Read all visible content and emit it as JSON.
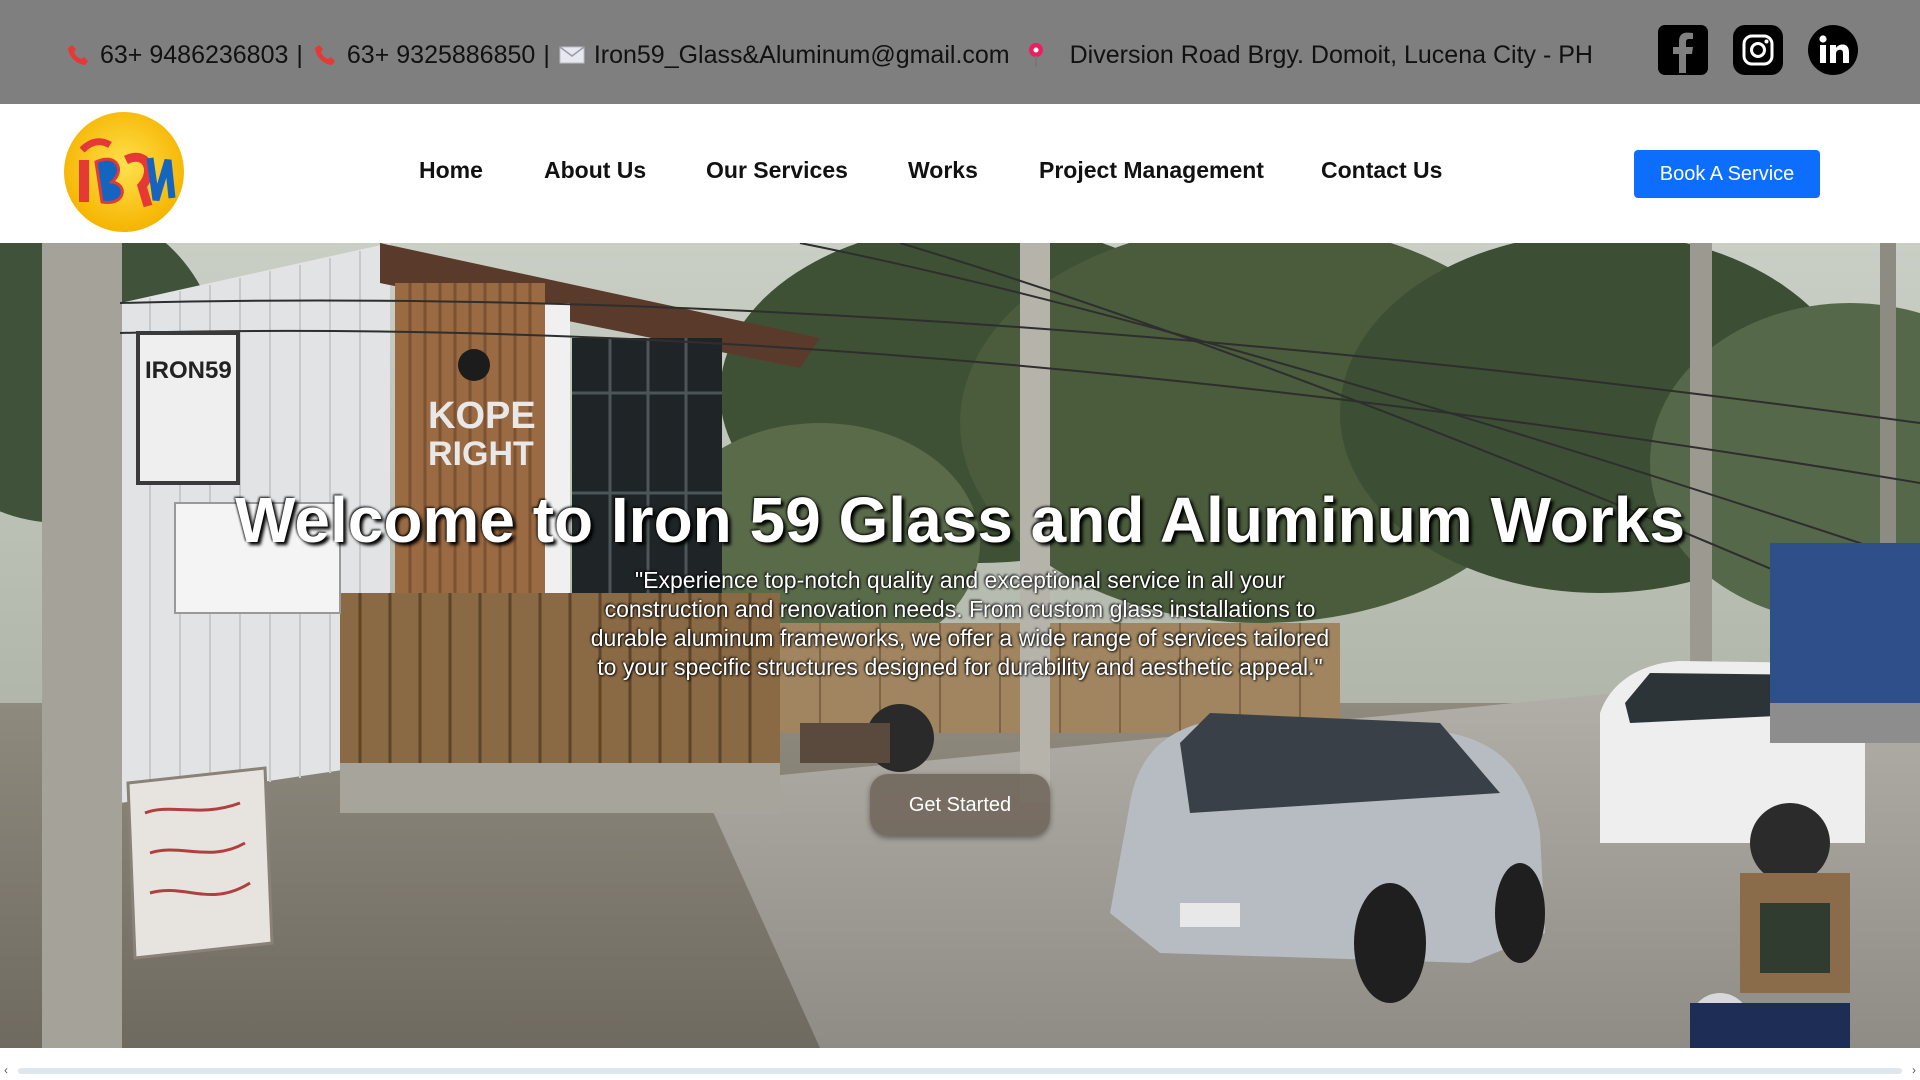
{
  "topbar": {
    "phone1": "63+ 9486236803",
    "phone2": "63+ 9325886850",
    "separator": "|",
    "email": "Iron59_Glass&Aluminum@gmail.com",
    "address": "Diversion Road Brgy. Domoit, Lucena City - PH",
    "icons": [
      "phone-icon",
      "mail-icon",
      "location-pin-icon"
    ],
    "social": [
      "facebook-icon",
      "instagram-icon",
      "linkedin-icon"
    ]
  },
  "nav": {
    "items": [
      "Home",
      "About Us",
      "Our Services",
      "Works",
      "Project Management",
      "Contact Us"
    ],
    "cta": "Book A Service"
  },
  "hero": {
    "title": "Welcome to Iron 59 Glass and Aluminum Works",
    "text": "\"Experience top-notch quality and exceptional service in all your construction and renovation needs. From custom glass installations to durable aluminum frameworks, we offer a wide range of services tailored to your specific structures designed for durability and aesthetic appeal.\"",
    "button": "Get Started",
    "sign_labels": [
      "IRON59",
      "KOPE",
      "RIGHT"
    ]
  },
  "colors": {
    "topbar": "#7f7f7f",
    "cta": "#0d6efd",
    "phone_icon": "#d32f2f"
  }
}
